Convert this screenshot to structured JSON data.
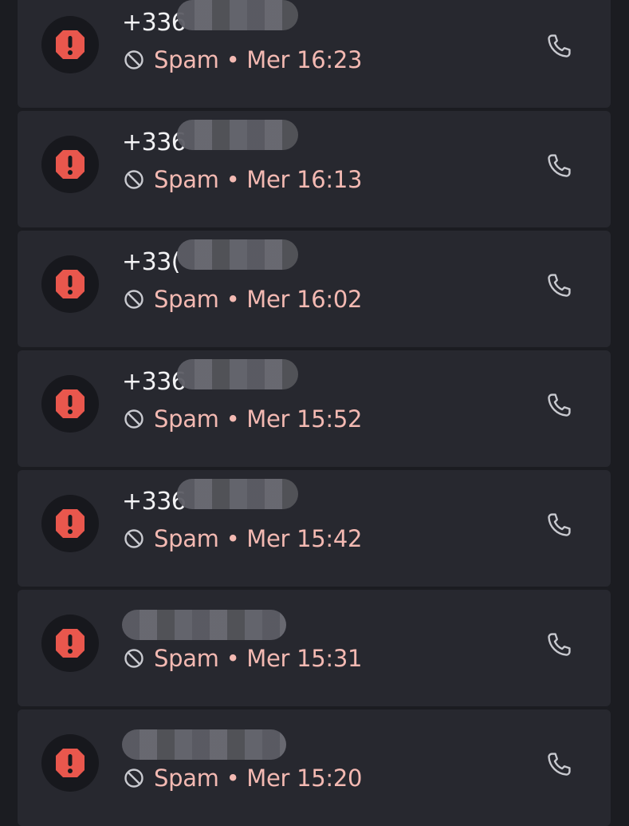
{
  "colors": {
    "background": "#1b1c21",
    "card": "#27282f",
    "spam_red": "#e9574d",
    "spam_text": "#f3b9b2",
    "number_text": "#f2f2f4",
    "icon": "#c9cad0"
  },
  "icons": {
    "avatar": "alert-exclamation-icon",
    "status": "block-icon",
    "action": "phone-icon"
  },
  "calls": [
    {
      "number": "+336",
      "status": "Spam",
      "sep": "•",
      "day": "Mer",
      "time": "16:23"
    },
    {
      "number": "+336",
      "status": "Spam",
      "sep": "•",
      "day": "Mer",
      "time": "16:13"
    },
    {
      "number": "+33(",
      "status": "Spam",
      "sep": "•",
      "day": "Mer",
      "time": "16:02"
    },
    {
      "number": "+336",
      "status": "Spam",
      "sep": "•",
      "day": "Mer",
      "time": "15:52"
    },
    {
      "number": "+336",
      "status": "Spam",
      "sep": "•",
      "day": "Mer",
      "time": "15:42"
    },
    {
      "number": "",
      "status": "Spam",
      "sep": "•",
      "day": "Mer",
      "time": "15:31"
    },
    {
      "number": "",
      "status": "Spam",
      "sep": "•",
      "day": "Mer",
      "time": "15:20"
    }
  ]
}
